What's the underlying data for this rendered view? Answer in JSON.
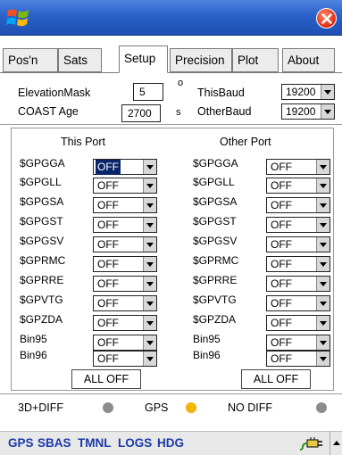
{
  "tabs": [
    "Pos'n",
    "Sats",
    "Setup",
    "Precision",
    "Plot",
    "About"
  ],
  "active_tab": "Setup",
  "settings": {
    "elevation_mask_label": "ElevationMask",
    "elevation_mask_value": "5",
    "elevation_mask_unit": "o",
    "coast_age_label": "COAST Age",
    "coast_age_value": "2700",
    "coast_age_unit": "s",
    "this_baud_label": "ThisBaud",
    "this_baud_value": "19200",
    "other_baud_label": "OtherBaud",
    "other_baud_value": "19200"
  },
  "this_port": {
    "title": "This Port",
    "rows": [
      {
        "label": "$GPGGA",
        "value": "OFF"
      },
      {
        "label": "$GPGLL",
        "value": "OFF"
      },
      {
        "label": "$GPGSA",
        "value": "OFF"
      },
      {
        "label": "$GPGST",
        "value": "OFF"
      },
      {
        "label": "$GPGSV",
        "value": "OFF"
      },
      {
        "label": "$GPRMC",
        "value": "OFF"
      },
      {
        "label": "$GPRRE",
        "value": "OFF"
      },
      {
        "label": "$GPVTG",
        "value": "OFF"
      },
      {
        "label": "$GPZDA",
        "value": "OFF"
      },
      {
        "label": "Bin95",
        "value": "OFF"
      },
      {
        "label": "Bin96",
        "value": "OFF"
      }
    ],
    "all_off_label": "ALL OFF"
  },
  "other_port": {
    "title": "Other Port",
    "rows": [
      {
        "label": "$GPGGA",
        "value": "OFF"
      },
      {
        "label": "$GPGLL",
        "value": "OFF"
      },
      {
        "label": "$GPGSA",
        "value": "OFF"
      },
      {
        "label": "$GPGST",
        "value": "OFF"
      },
      {
        "label": "$GPGSV",
        "value": "OFF"
      },
      {
        "label": "$GPRMC",
        "value": "OFF"
      },
      {
        "label": "$GPRRE",
        "value": "OFF"
      },
      {
        "label": "$GPVTG",
        "value": "OFF"
      },
      {
        "label": "$GPZDA",
        "value": "OFF"
      },
      {
        "label": "Bin95",
        "value": "OFF"
      },
      {
        "label": "Bin96",
        "value": "OFF"
      }
    ],
    "all_off_label": "ALL OFF"
  },
  "status": {
    "diff_mode": "3D+DIFF",
    "diff_led_color": "#8c8c8c",
    "gps_label": "GPS",
    "gps_led_color": "#f5b400",
    "no_diff_label": "NO DIFF",
    "no_diff_led_color": "#8c8c8c"
  },
  "bottom_menu": {
    "items": [
      "GPS",
      "SBAS",
      "TMNL",
      "LOGS",
      "HDG"
    ],
    "active_color": "#1a3aa8",
    "normal_color": "#000000"
  }
}
